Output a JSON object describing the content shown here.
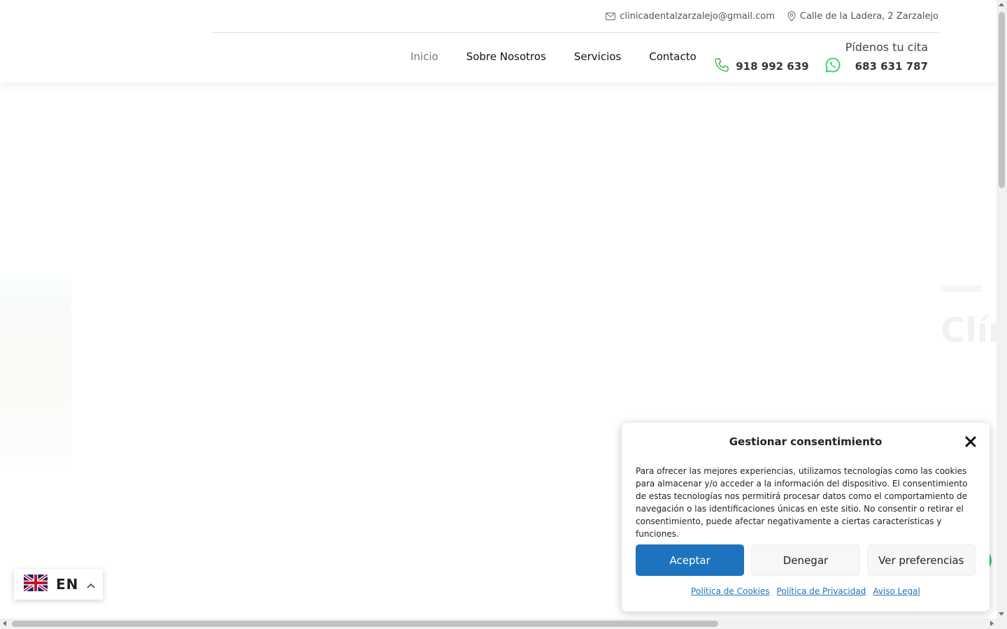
{
  "topbar": {
    "email": "clinicadentalzarzalejo@gmail.com",
    "address": "Calle de la Ladera, 2 Zarzalejo"
  },
  "nav": {
    "items": [
      {
        "label": "Inicio",
        "active": true
      },
      {
        "label": "Sobre Nosotros"
      },
      {
        "label": "Servicios"
      },
      {
        "label": "Contacto"
      }
    ]
  },
  "cta": {
    "title": "Pídenos tu cita",
    "phone": "918 992 639",
    "whatsapp": "683 631 787"
  },
  "colors": {
    "accent_green": "#25d366",
    "button_blue": "#1e73be"
  },
  "consent": {
    "title": "Gestionar consentimiento",
    "text": "Para ofrecer las mejores experiencias, utilizamos tecnologías como las cookies para almacenar y/o acceder a la información del dispositivo. El consentimiento de estas tecnologías nos permitirá procesar datos como el comportamiento de navegación o las identificaciones únicas en este sitio. No consentir o retirar el consentimiento, puede afectar negativamente a ciertas características y funciones.",
    "accept_label": "Aceptar",
    "deny_label": "Denegar",
    "prefs_label": "Ver preferencias",
    "links": {
      "cookies": "Política de Cookies",
      "privacy": "Política de Privacidad",
      "legal": "Aviso Legal"
    }
  },
  "language": {
    "code": "EN",
    "flag_icon": "uk-flag-icon"
  }
}
